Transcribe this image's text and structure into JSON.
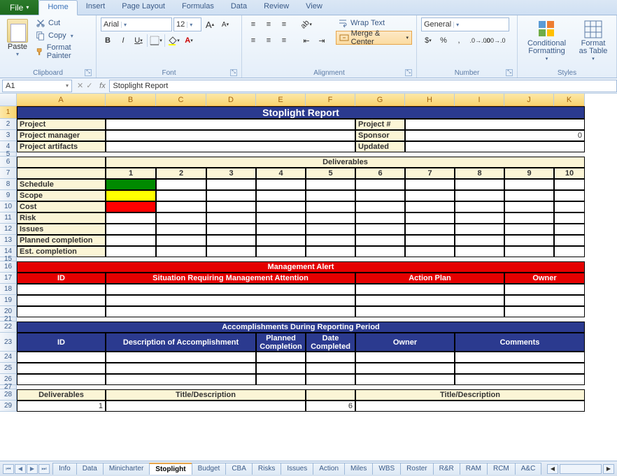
{
  "app": {
    "file_tab": "File"
  },
  "tabs": [
    "Home",
    "Insert",
    "Page Layout",
    "Formulas",
    "Data",
    "Review",
    "View"
  ],
  "ribbon": {
    "clipboard": {
      "paste": "Paste",
      "cut": "Cut",
      "copy": "Copy",
      "format_painter": "Format Painter",
      "label": "Clipboard"
    },
    "font": {
      "name": "Arial",
      "size": "12",
      "label": "Font"
    },
    "alignment": {
      "wrap": "Wrap Text",
      "merge": "Merge & Center",
      "label": "Alignment"
    },
    "number": {
      "format": "General",
      "label": "Number"
    },
    "styles": {
      "conditional": "Conditional Formatting",
      "format_table": "Format as Table",
      "label": "Styles"
    }
  },
  "namebox": "A1",
  "formula": "Stoplight Report",
  "columns": [
    "A",
    "B",
    "C",
    "D",
    "E",
    "F",
    "G",
    "H",
    "I",
    "J",
    "K"
  ],
  "sheet": {
    "title": "Stoplight Report",
    "project_lbl": "Project",
    "project_num_lbl": "Project #",
    "pm_lbl": "Project manager",
    "sponsor_lbl": "Sponsor",
    "sponsor_val": "0",
    "artifacts_lbl": "Project artifacts",
    "updated_lbl": "Updated",
    "deliverables_hdr": "Deliverables",
    "del_nums": [
      "1",
      "2",
      "3",
      "4",
      "5",
      "6",
      "7",
      "8",
      "9",
      "10"
    ],
    "rows": [
      "Schedule",
      "Scope",
      "Cost",
      "Risk",
      "Issues",
      "Planned completion",
      "Est. completion"
    ],
    "mgmt_alert": "Management Alert",
    "ma_cols": [
      "ID",
      "Situation Requiring Management Attention",
      "Action Plan",
      "Owner"
    ],
    "accomp_hdr": "Accomplishments During Reporting Period",
    "ac_cols": [
      "ID",
      "Description of Accomplishment",
      "Planned Completion",
      "Date Completed",
      "Owner",
      "Comments"
    ],
    "deliv2": "Deliverables",
    "td": "Title/Description",
    "one": "1",
    "six": "6"
  },
  "sheettabs": [
    "Info",
    "Data",
    "Minicharter",
    "Stoplight",
    "Budget",
    "CBA",
    "Risks",
    "Issues",
    "Action",
    "Miles",
    "WBS",
    "Roster",
    "R&R",
    "RAM",
    "RCM",
    "A&C"
  ],
  "active_sheet": "Stoplight"
}
